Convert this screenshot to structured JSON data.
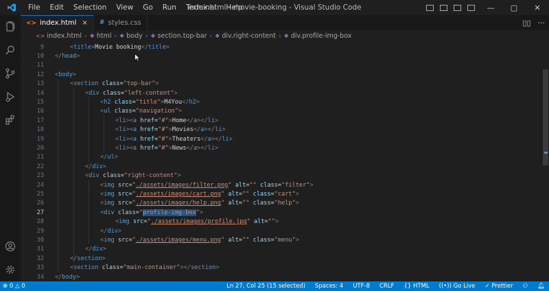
{
  "window": {
    "title": "index.html - movie-booking - Visual Studio Code",
    "menu": [
      "File",
      "Edit",
      "Selection",
      "View",
      "Go",
      "Run",
      "Terminal",
      "Help"
    ],
    "controls": {
      "minimize": "—",
      "maximize": "▢",
      "close": "✕"
    }
  },
  "tabs": [
    {
      "label": "index.html",
      "icon": "html-file-icon",
      "active": true,
      "close": "×"
    },
    {
      "label": "styles.css",
      "icon": "css-file-icon",
      "active": false
    }
  ],
  "tab_actions": {
    "split": "▯▯",
    "more": "···"
  },
  "breadcrumb": [
    "index.html",
    "html",
    "body",
    "section.top-bar",
    "div.right-content",
    "div.profile-img-box"
  ],
  "editor": {
    "lines": [
      {
        "n": "9"
      },
      {
        "n": "10"
      },
      {
        "n": "11"
      },
      {
        "n": "12"
      },
      {
        "n": "13"
      },
      {
        "n": "14"
      },
      {
        "n": "15"
      },
      {
        "n": "16"
      },
      {
        "n": "17"
      },
      {
        "n": "18"
      },
      {
        "n": "19"
      },
      {
        "n": "20"
      },
      {
        "n": "21"
      },
      {
        "n": "22"
      },
      {
        "n": "23"
      },
      {
        "n": "24"
      },
      {
        "n": "25"
      },
      {
        "n": "26"
      },
      {
        "n": "27"
      },
      {
        "n": "28"
      },
      {
        "n": "29"
      },
      {
        "n": "30"
      },
      {
        "n": "31"
      },
      {
        "n": "32"
      },
      {
        "n": "33"
      },
      {
        "n": "34"
      }
    ],
    "code": {
      "title_text": "Movie booking",
      "title_class": "\"title\"",
      "brand": "M4You",
      "section_class": "\"top-bar\"",
      "left_class": "\"left-content\"",
      "nav_class": "\"navigation\"",
      "href": "\"#\"",
      "nav_home": "Home",
      "nav_movies": "Movies",
      "nav_theaters": "Theaters",
      "nav_news": "News",
      "right_class": "\"right-content\"",
      "img1_src": "./assets/images/filter.png",
      "img1_class": "\"filter\"",
      "img2_src": "./assets/images/cart.png",
      "img2_class": "\"cart\"",
      "img3_src": "./assets/images/help.png",
      "img3_class": "\"help\"",
      "box_class": "profile-img-box",
      "img4_src": "./assets/images/profile.jpg",
      "img5_src": "./assets/images/menu.png",
      "img5_class": "\"menu\"",
      "main_class": "\"main-container\"",
      "empty_alt": "\"\"",
      "quote": "\""
    }
  },
  "status": {
    "errors": "0",
    "warnings": "0",
    "position": "Ln 27, Col 25 (15 selected)",
    "spaces": "Spaces: 4",
    "encoding": "UTF-8",
    "eol": "CRLF",
    "language": "HTML",
    "golive": "Go Live",
    "prettier": "Prettier"
  },
  "colors": {
    "accent": "#007acc",
    "tag": "#569cd6",
    "attr": "#9cdcfe",
    "string": "#ce9178"
  }
}
